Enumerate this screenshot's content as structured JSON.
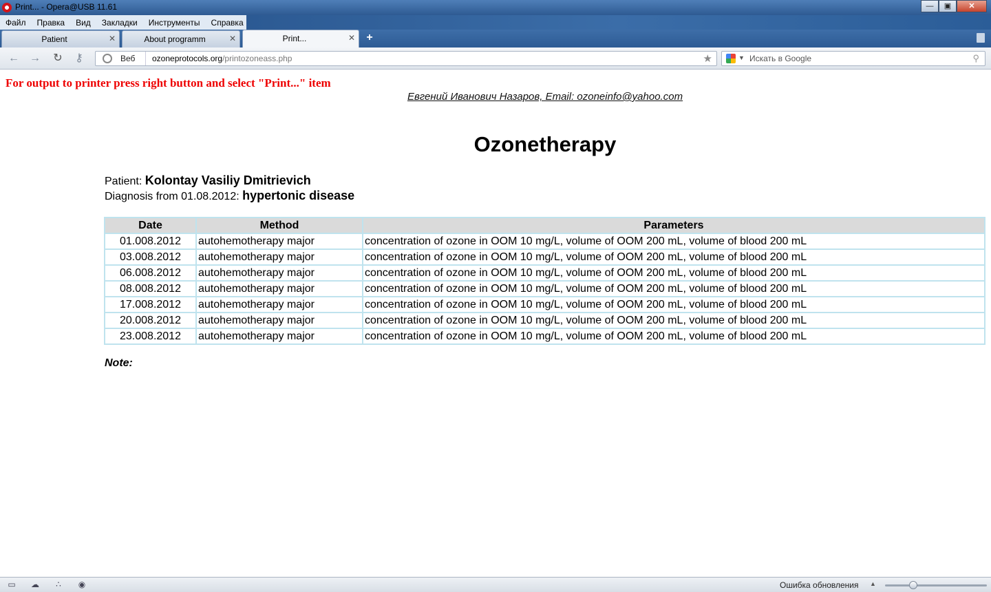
{
  "window": {
    "title": "Print... - Opera@USB 11.61"
  },
  "menu": [
    "Файл",
    "Правка",
    "Вид",
    "Закладки",
    "Инструменты",
    "Справка"
  ],
  "tabs": [
    {
      "label": "Patient"
    },
    {
      "label": "About programm"
    },
    {
      "label": "Print..."
    }
  ],
  "address": {
    "web_label": "Веб",
    "host": "ozoneprotocols.org",
    "path": "/printozoneass.php"
  },
  "search": {
    "placeholder": "Искать в Google"
  },
  "page": {
    "print_hint": "For output to printer press right button and select \"Print...\" item",
    "author": "Евгений Иванович Назаров, Email: ozoneinfo@yahoo.com",
    "heading": "Ozonetherapy",
    "patient_label": "Patient: ",
    "patient_name": "Kolontay Vasiliy Dmitrievich",
    "diagnosis_label": "Diagnosis from 01.08.2012: ",
    "diagnosis_value": "hypertonic disease",
    "table": {
      "headers": [
        "Date",
        "Method",
        "Parameters"
      ],
      "rows": [
        [
          "01.008.2012",
          "autohemotherapy major",
          "concentration of ozone in OOM 10 mg/L, volume of OOM 200 mL, volume of blood 200 mL"
        ],
        [
          "03.008.2012",
          "autohemotherapy major",
          "concentration of ozone in OOM 10 mg/L, volume of OOM 200 mL, volume of blood 200 mL"
        ],
        [
          "06.008.2012",
          "autohemotherapy major",
          "concentration of ozone in OOM 10 mg/L, volume of OOM 200 mL, volume of blood 200 mL"
        ],
        [
          "08.008.2012",
          "autohemotherapy major",
          "concentration of ozone in OOM 10 mg/L, volume of OOM 200 mL, volume of blood 200 mL"
        ],
        [
          "17.008.2012",
          "autohemotherapy major",
          "concentration of ozone in OOM 10 mg/L, volume of OOM 200 mL, volume of blood 200 mL"
        ],
        [
          "20.008.2012",
          "autohemotherapy major",
          "concentration of ozone in OOM 10 mg/L, volume of OOM 200 mL, volume of blood 200 mL"
        ],
        [
          "23.008.2012",
          "autohemotherapy major",
          "concentration of ozone in OOM 10 mg/L, volume of OOM 200 mL, volume of blood 200 mL"
        ]
      ]
    },
    "note_label": "Note:"
  },
  "status": {
    "update_text": "Ошибка обновления",
    "zoom_fraction": 0.28
  },
  "colors": {
    "hint_red": "#ee0000",
    "table_border": "#bfe3ee",
    "table_header_bg": "#dadada"
  }
}
